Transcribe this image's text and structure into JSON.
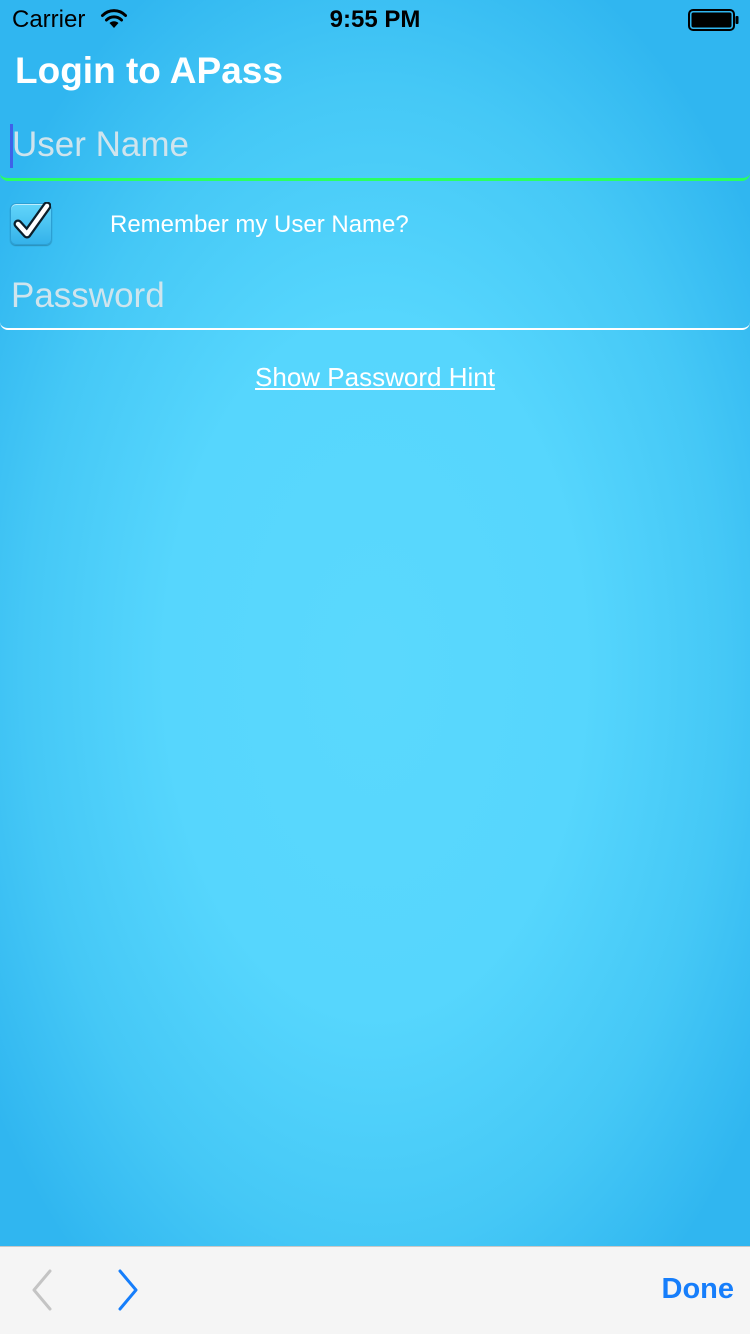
{
  "status_bar": {
    "carrier": "Carrier",
    "time": "9:55 PM",
    "icons": [
      "wifi-icon",
      "battery-icon"
    ]
  },
  "header": {
    "title": "Login to APass"
  },
  "form": {
    "username": {
      "value": "",
      "placeholder": "User Name"
    },
    "remember": {
      "label": "Remember my User Name?",
      "checked": true
    },
    "password": {
      "value": "",
      "placeholder": "Password"
    },
    "hint_link": "Show Password Hint"
  },
  "toolbar": {
    "previous_icon": "chevron-left-icon",
    "next_icon": "chevron-right-icon",
    "done_label": "Done"
  },
  "colors": {
    "background_center": "#5ad8fd",
    "background_edge": "#30b6f0",
    "username_underline": "#2aff63",
    "cursor": "#3f62e8",
    "toolbar_accent": "#167efb",
    "toolbar_disabled": "#c4c4c4"
  }
}
